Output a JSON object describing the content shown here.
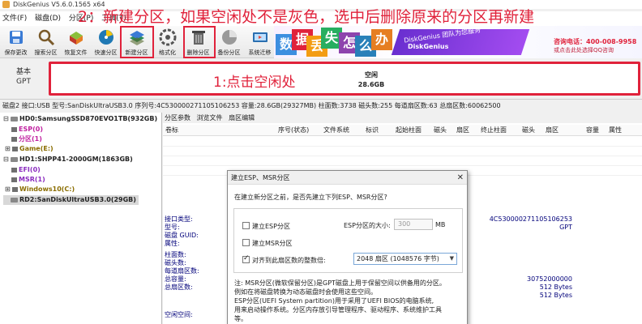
{
  "window": {
    "title": "DiskGenius V5.6.0.1565 x64"
  },
  "annotations": {
    "top": "2：新建分区，如果空闲处不是灰色，选中后删除原来的分区再新建",
    "disk": "1:点击空闲处"
  },
  "menu": [
    "文件(F)",
    "磁盘(D)",
    "分区(P)",
    "工具(T)"
  ],
  "toolbar": [
    {
      "label": "保存更改",
      "icon": "save-icon",
      "color": "#3a7bd5"
    },
    {
      "label": "搜索分区",
      "icon": "search-icon",
      "color": "#7a5a2a"
    },
    {
      "label": "恢复文件",
      "icon": "recover-icon",
      "color": "#c0392b"
    },
    {
      "label": "快速分区",
      "icon": "quick-partition-icon",
      "color": "#1f78b4"
    },
    {
      "label": "新建分区",
      "icon": "new-partition-icon",
      "color": "#2e8b57"
    },
    {
      "label": "格式化",
      "icon": "format-icon",
      "color": "#555555"
    },
    {
      "label": "删除分区",
      "icon": "delete-partition-icon",
      "color": "#666666"
    },
    {
      "label": "备份分区",
      "icon": "backup-icon",
      "color": "#777777"
    },
    {
      "label": "系统迁移",
      "icon": "migrate-icon",
      "color": "#2a6fb0"
    }
  ],
  "banner": {
    "cubes": [
      {
        "char": "数",
        "color": "#3d8fe0"
      },
      {
        "char": "据",
        "color": "#e0223b"
      },
      {
        "char": "丢",
        "color": "#f39c12"
      },
      {
        "char": "失",
        "color": "#27ae60"
      },
      {
        "char": "怎",
        "color": "#8e44ad"
      },
      {
        "char": "么",
        "color": "#2980b9"
      },
      {
        "char": "办",
        "color": "#e67e22"
      }
    ],
    "slogan": "DiskGenius 团队为您服务",
    "brand": "DiskGenius",
    "phone": "咨询电话：400-008-9958",
    "qq": "或点击此处选择QQ咨询"
  },
  "disk_map": {
    "disk_label_line1": "基本",
    "disk_label_line2": "GPT",
    "free_name": "空闲",
    "free_size": "28.6GB"
  },
  "disk_info": "磁盘2 接口:USB  型号:SanDiskUltraUSB3.0  序列号:4C530000271105106253  容量:28.6GB(29327MB)  柱面数:3738  磁头数:255  每道扇区数:63  总扇区数:60062500",
  "tree": [
    {
      "toggle": "⊟",
      "text": "HD0:SamsungSSD870EVO1TB(932GB)",
      "kind": "disk",
      "indent": 0,
      "color": "#222222"
    },
    {
      "toggle": "",
      "text": "ESP(0)",
      "kind": "part",
      "indent": 1,
      "color": "#c020a0"
    },
    {
      "toggle": "",
      "text": "分区(1)",
      "kind": "part",
      "indent": 1,
      "color": "#c020a0"
    },
    {
      "toggle": "⊞",
      "text": "Game(E:)",
      "kind": "part",
      "indent": 1,
      "color": "#8a6d00"
    },
    {
      "toggle": "⊟",
      "text": "HD1:SHPP41-2000GM(1863GB)",
      "kind": "disk",
      "indent": 0,
      "color": "#222222"
    },
    {
      "toggle": "",
      "text": "EFI(0)",
      "kind": "part",
      "indent": 1,
      "color": "#8a2bbf"
    },
    {
      "toggle": "",
      "text": "MSR(1)",
      "kind": "part",
      "indent": 1,
      "color": "#8a2bbf"
    },
    {
      "toggle": "⊞",
      "text": "Windows10(C:)",
      "kind": "part",
      "indent": 1,
      "color": "#8a6d00"
    },
    {
      "toggle": "",
      "text": "RD2:SanDiskUltraUSB3.0(29GB)",
      "kind": "disk",
      "indent": 0,
      "color": "#222222",
      "selected": true
    }
  ],
  "tabs": [
    "分区参数",
    "浏览文件",
    "扇区编辑"
  ],
  "columns": [
    "卷标",
    "序号(状态)",
    "文件系统",
    "标识",
    "起始柱面",
    "磁头",
    "扇区",
    "终止柱面",
    "磁头",
    "扇区",
    "容量",
    "属性"
  ],
  "props": {
    "group1": [
      "接口类型:",
      "型号:",
      "磁盘 GUID:",
      "属性:"
    ],
    "group2": [
      "柱面数:",
      "磁头数:",
      "每道扇区数:",
      "总容量:",
      "总扇区数:"
    ],
    "group3": [
      "空闲空间:"
    ],
    "serial": "4C530000271105106253",
    "serial_type": "GPT",
    "capacity_bytes": "30752000000",
    "sector_size": "512 Bytes",
    "phys_sector_size": "512 Bytes"
  },
  "dialog": {
    "title": "建立ESP、MSR分区",
    "close": "✕",
    "question": "在建立新分区之前，是否先建立下列ESP、MSR分区?",
    "esp_label": "建立ESP分区",
    "esp_checked": false,
    "esp_size_label": "ESP分区的大小:",
    "esp_size_value": "300",
    "esp_size_unit": "MB",
    "msr_label": "建立MSR分区",
    "msr_checked": false,
    "align_label": "对齐到此扇区数的整数倍:",
    "align_checked": true,
    "align_value": "2048 扇区 (1048576 字节)",
    "notes": [
      "注: MSR分区(微软保留分区)是GPT磁盘上用于保留空间以供备用的分区。",
      "例如在将磁盘转换为动态磁盘时会使用这些空间。",
      "    ESP分区(UEFI System partition)用于采用了UEFI BIOS的电脑系统,",
      "    用来启动操作系统。分区内存放引导管理程序、驱动程序、系统维护工具",
      "    等。"
    ]
  }
}
